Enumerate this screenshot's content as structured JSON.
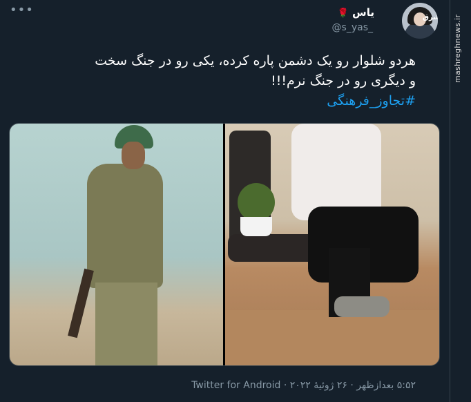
{
  "tweet": {
    "author": {
      "display_name": "یاس",
      "emoji": "🌹",
      "handle": "@s_yas_"
    },
    "text_lines": [
      "هردو شلوار رو یک دشمن پاره کرده، یکی رو در جنگ سخت",
      "و دیگری رو در جنگ نرم!!!"
    ],
    "hashtag": "#تجاوز_فرهنگی",
    "more_icon": "•••",
    "footer": {
      "time": "۵:۵۲ بعدازظهر",
      "date": "۲۶ ژوئیهٔ ۲۰۲۲",
      "source": "Twitter for Android",
      "separator": "·"
    }
  },
  "watermark": "mashreghnews.ir",
  "avatar_stamp": "مشرق",
  "media": {
    "left_image": "soldier-photo",
    "right_image": "ripped-jeans-photo"
  }
}
